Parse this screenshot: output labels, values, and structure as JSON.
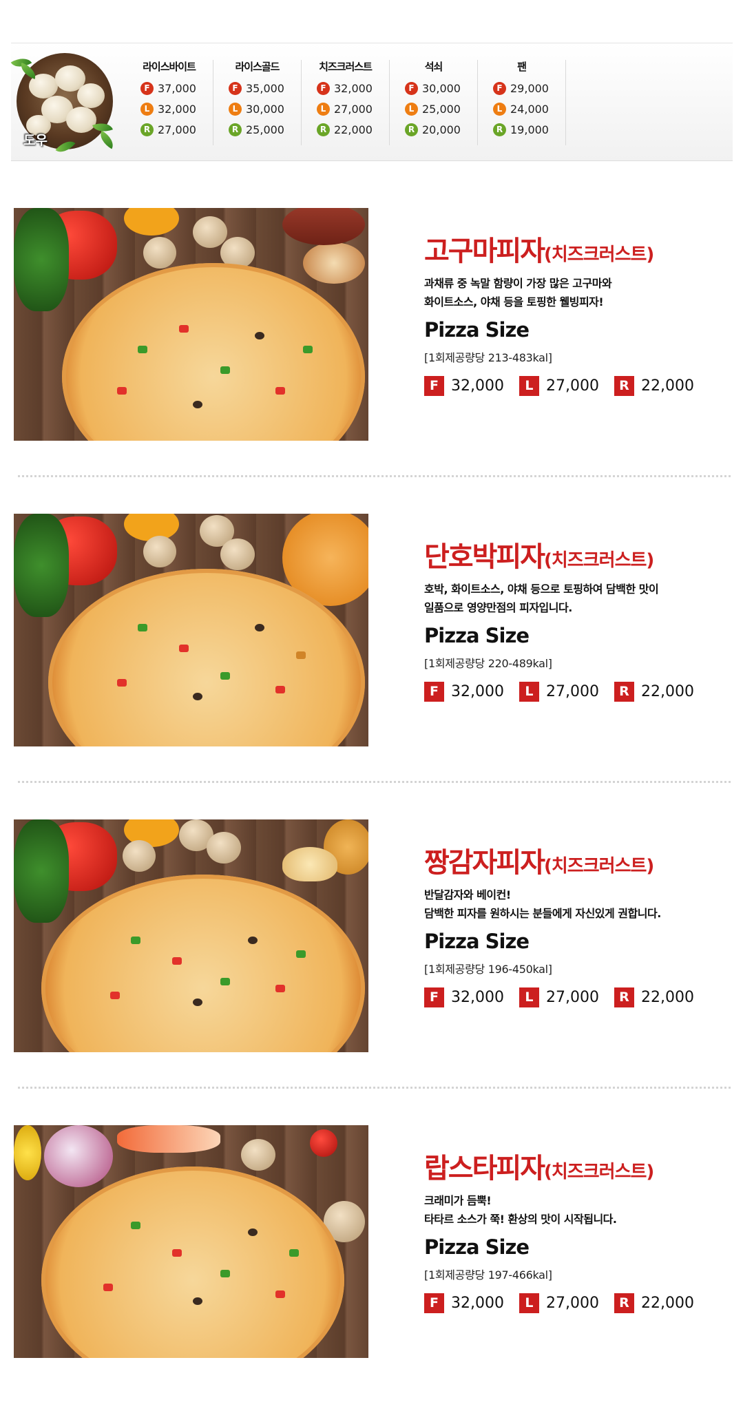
{
  "dough": {
    "label": "도우",
    "columns": [
      {
        "name": "라이스바이트",
        "prices": [
          {
            "size": "F",
            "price": "37,000"
          },
          {
            "size": "L",
            "price": "32,000"
          },
          {
            "size": "R",
            "price": "27,000"
          }
        ]
      },
      {
        "name": "라이스골드",
        "prices": [
          {
            "size": "F",
            "price": "35,000"
          },
          {
            "size": "L",
            "price": "30,000"
          },
          {
            "size": "R",
            "price": "25,000"
          }
        ]
      },
      {
        "name": "치즈크러스트",
        "prices": [
          {
            "size": "F",
            "price": "32,000"
          },
          {
            "size": "L",
            "price": "27,000"
          },
          {
            "size": "R",
            "price": "22,000"
          }
        ]
      },
      {
        "name": "석쇠",
        "prices": [
          {
            "size": "F",
            "price": "30,000"
          },
          {
            "size": "L",
            "price": "25,000"
          },
          {
            "size": "R",
            "price": "20,000"
          }
        ]
      },
      {
        "name": "팬",
        "prices": [
          {
            "size": "F",
            "price": "29,000"
          },
          {
            "size": "L",
            "price": "24,000"
          },
          {
            "size": "R",
            "price": "19,000"
          }
        ]
      }
    ]
  },
  "pizzas": [
    {
      "name": "고구마피자",
      "crust": "(치즈크러스트)",
      "desc": [
        "과채류 중 녹말 함량이 가장 많은 고구마와",
        "화이트소스, 야채 등을 토핑한 웰빙피자!"
      ],
      "size_heading": "Pizza Size",
      "calorie": "[1회제공량당 213-483kal]",
      "prices": [
        {
          "size": "F",
          "price": "32,000"
        },
        {
          "size": "L",
          "price": "27,000"
        },
        {
          "size": "R",
          "price": "22,000"
        }
      ]
    },
    {
      "name": "단호박피자",
      "crust": "(치즈크러스트)",
      "desc": [
        "호박, 화이트소스, 야채 등으로 토핑하여 담백한 맛이",
        "일품으로 영양만점의 피자입니다."
      ],
      "size_heading": "Pizza Size",
      "calorie": "[1회제공량당 220-489kal]",
      "prices": [
        {
          "size": "F",
          "price": "32,000"
        },
        {
          "size": "L",
          "price": "27,000"
        },
        {
          "size": "R",
          "price": "22,000"
        }
      ]
    },
    {
      "name": "짱감자피자",
      "crust": "(치즈크러스트)",
      "desc": [
        "반달감자와 베이컨!",
        "담백한 피자를 원하시는 분들에게 자신있게 권합니다."
      ],
      "size_heading": "Pizza Size",
      "calorie": "[1회제공량당 196-450kal]",
      "prices": [
        {
          "size": "F",
          "price": "32,000"
        },
        {
          "size": "L",
          "price": "27,000"
        },
        {
          "size": "R",
          "price": "22,000"
        }
      ]
    },
    {
      "name": "랍스타피자",
      "crust": "(치즈크러스트)",
      "desc": [
        "크래미가 듬뿍!",
        "타타르 소스가 쭉! 환상의 맛이 시작됩니다."
      ],
      "size_heading": "Pizza Size",
      "calorie": "[1회제공량당 197-466kal]",
      "prices": [
        {
          "size": "F",
          "price": "32,000"
        },
        {
          "size": "L",
          "price": "27,000"
        },
        {
          "size": "R",
          "price": "22,000"
        }
      ]
    }
  ],
  "colors": {
    "accent_red": "#cc1f1f",
    "size_F": "#d6331a",
    "size_L": "#ee7d12",
    "size_R": "#6aa527"
  }
}
